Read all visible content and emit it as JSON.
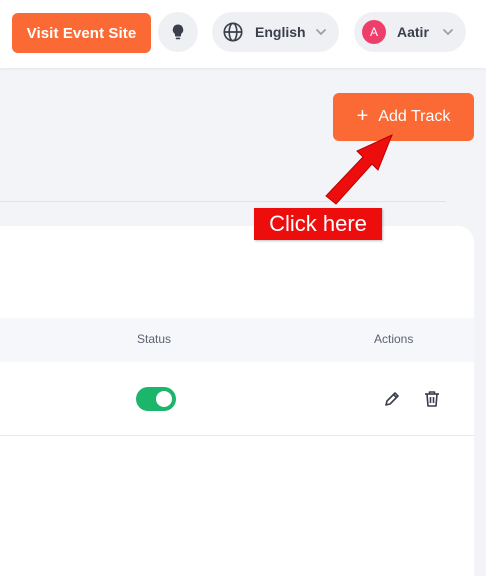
{
  "header": {
    "visit_button": "Visit Event Site",
    "bulb_icon": "lightbulb-icon",
    "language": {
      "label": "English",
      "icon": "globe-icon"
    },
    "user": {
      "initial": "A",
      "name": "Aatir",
      "avatar_color": "#ee3e6a"
    }
  },
  "toolbar": {
    "add_track_label": "Add Track",
    "add_icon": "plus-icon"
  },
  "table": {
    "columns": {
      "status": "Status",
      "actions": "Actions"
    },
    "rows": [
      {
        "status_enabled": true
      }
    ]
  },
  "annotation": {
    "text": "Click here"
  },
  "colors": {
    "accent": "#fb6a34",
    "toggle_on": "#1bb56b",
    "annotation": "#ee0d0d"
  }
}
